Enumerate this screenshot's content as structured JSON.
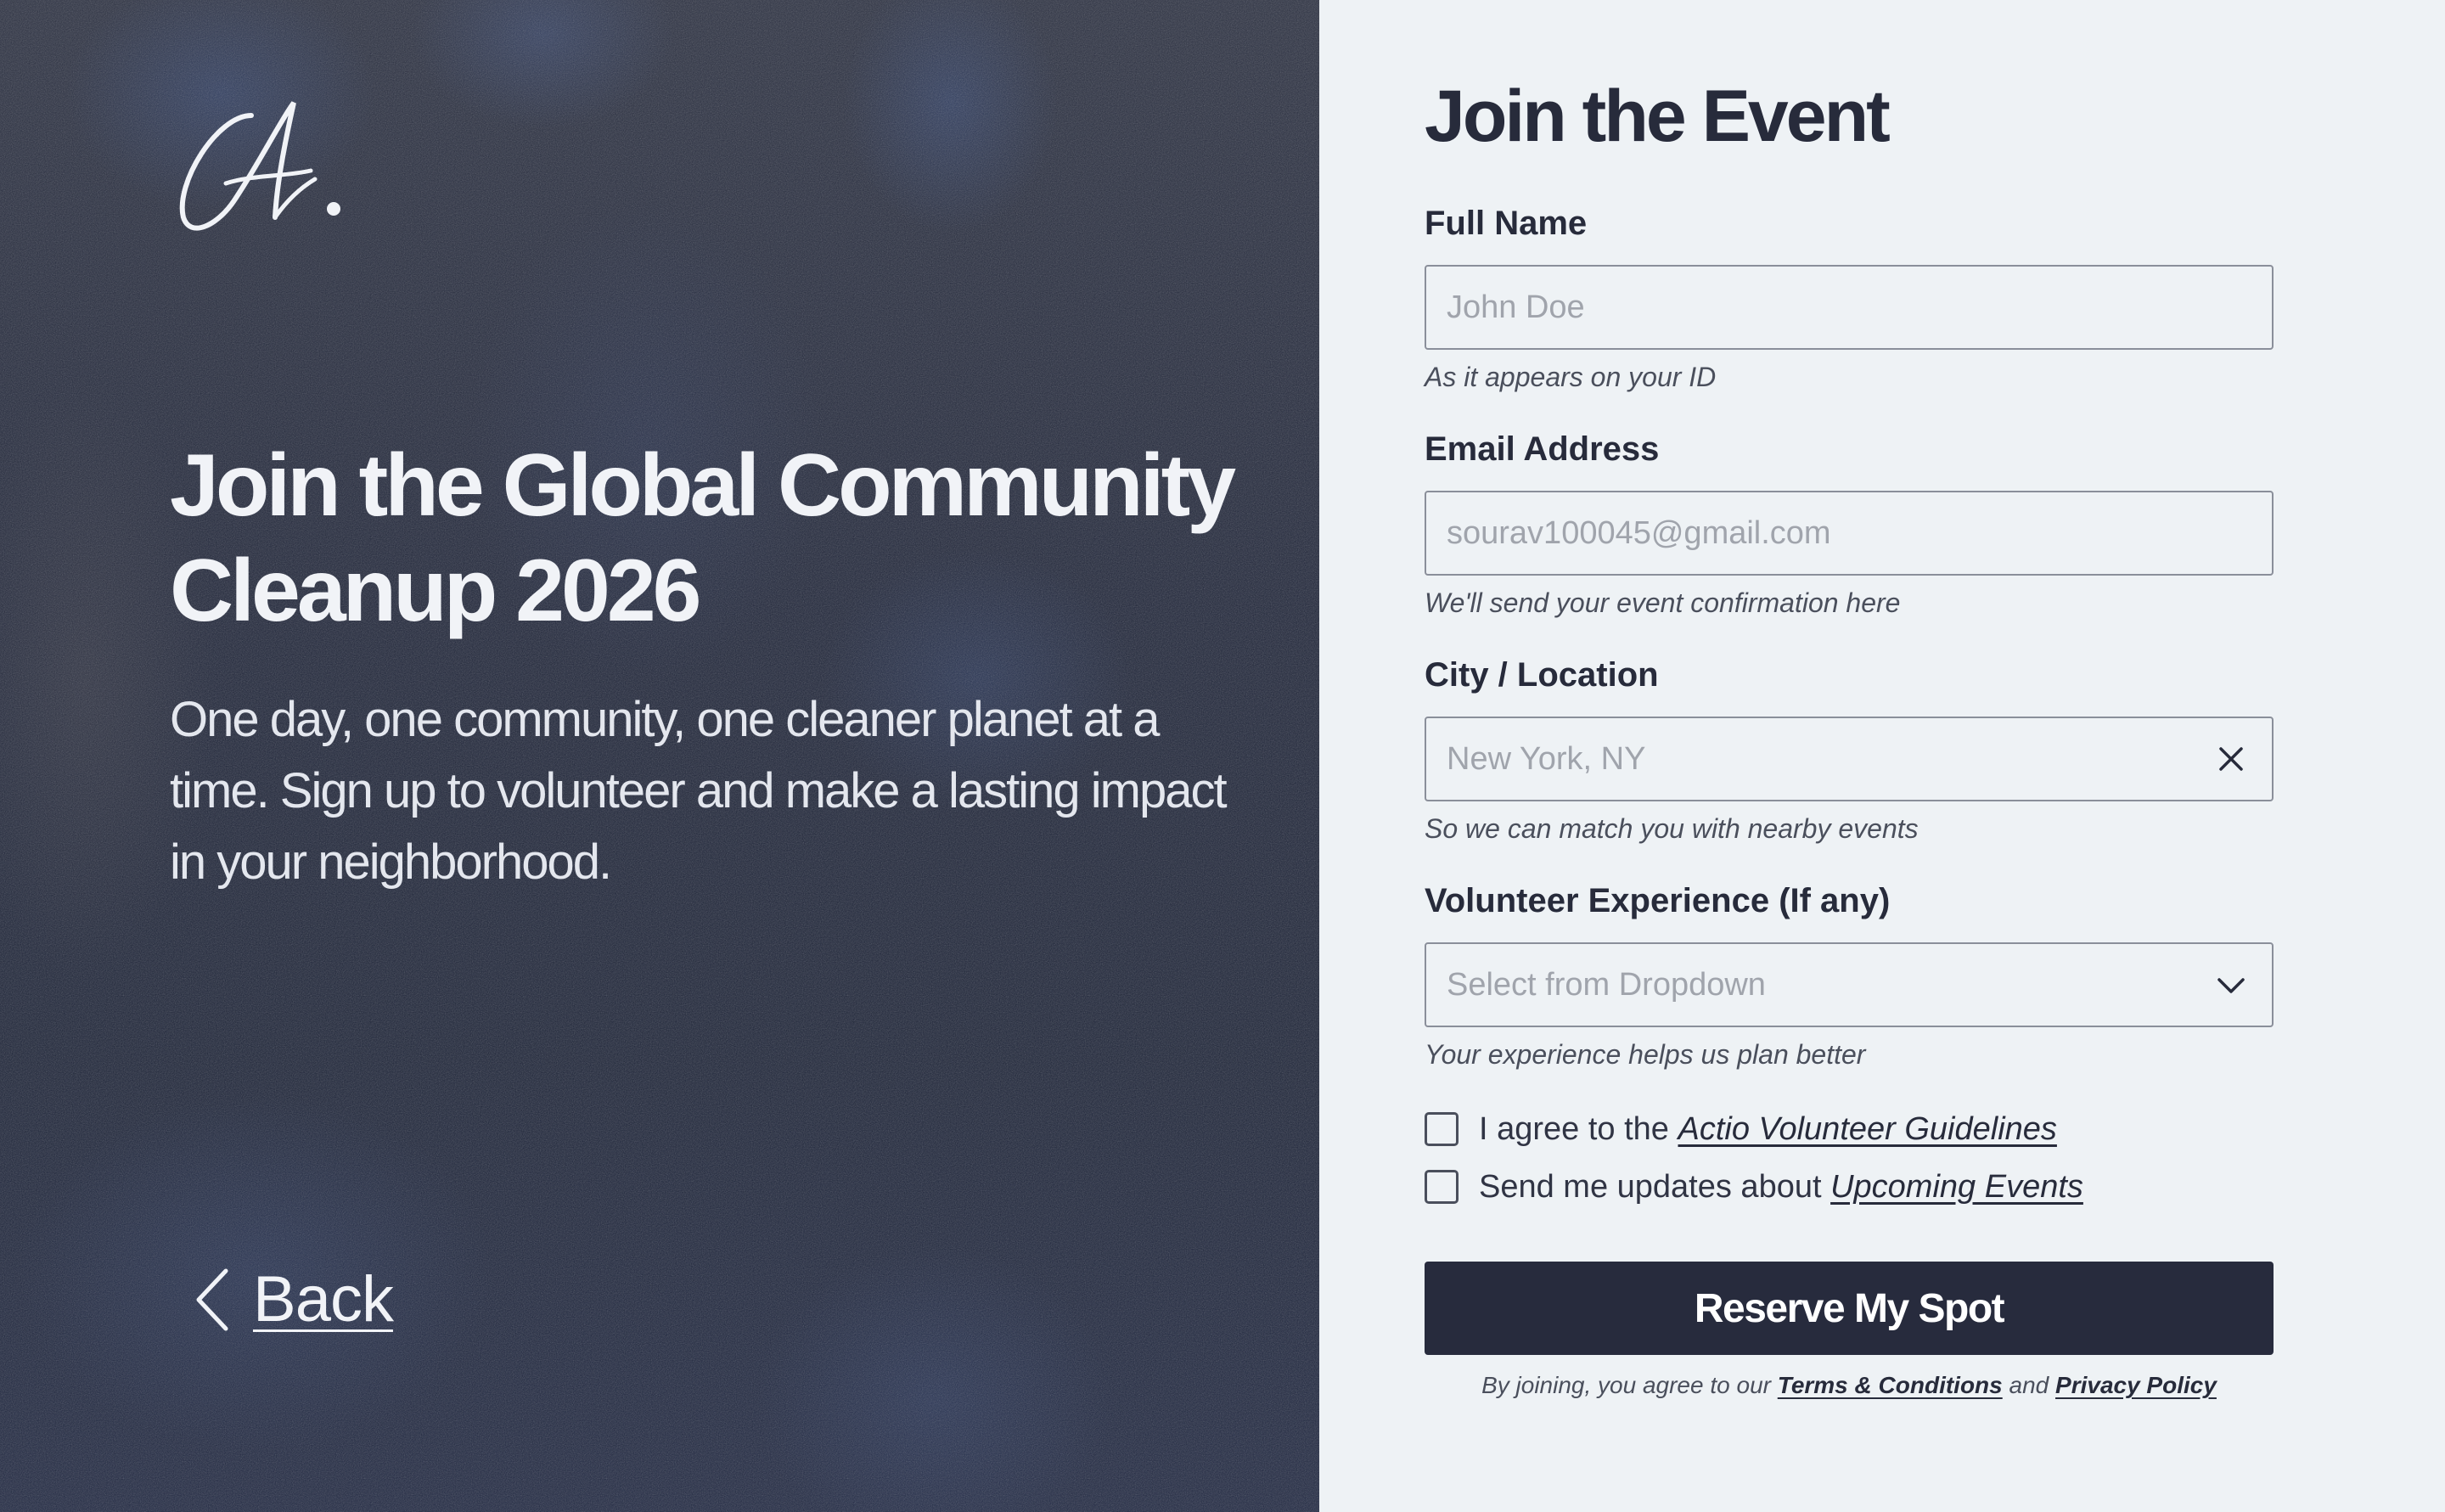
{
  "hero": {
    "title": "Join the Global Community Cleanup  2026",
    "subtitle": "One day, one community, one cleaner planet at a time. Sign up to volunteer and make a lasting impact in your neighborhood.",
    "back_label": "Back",
    "logo_text": "A."
  },
  "form": {
    "title": "Join the Event",
    "full_name": {
      "label": "Full Name",
      "placeholder": "John Doe",
      "helper": "As it appears on your ID"
    },
    "email": {
      "label": "Email Address",
      "placeholder": "sourav100045@gmail.com",
      "helper": "We'll send your event confirmation here"
    },
    "city": {
      "label": "City / Location",
      "placeholder": "New York, NY",
      "helper": "So we can match you with nearby events"
    },
    "experience": {
      "label": "Volunteer Experience (If any)",
      "selected": "Select from Dropdown",
      "helper": "Your experience helps us plan better"
    },
    "agree": {
      "text": "I agree to the ",
      "link": "Actio Volunteer Guidelines"
    },
    "updates": {
      "text": "Send me updates about ",
      "link": "Upcoming Events"
    },
    "submit_label": "Reserve My Spot",
    "legal": {
      "prefix": "By joining, you agree to our ",
      "terms": "Terms & Conditions",
      "middle": " and ",
      "privacy": "Privacy Policy"
    }
  },
  "colors": {
    "panel_dark": "#202840",
    "form_bg": "#eef2f5",
    "button": "#272b3d",
    "text_dark": "#272b3b"
  },
  "icons": {
    "logo": "script-monogram",
    "back": "chevron-left-icon",
    "clear": "close-icon",
    "dropdown": "chevron-down-icon"
  }
}
